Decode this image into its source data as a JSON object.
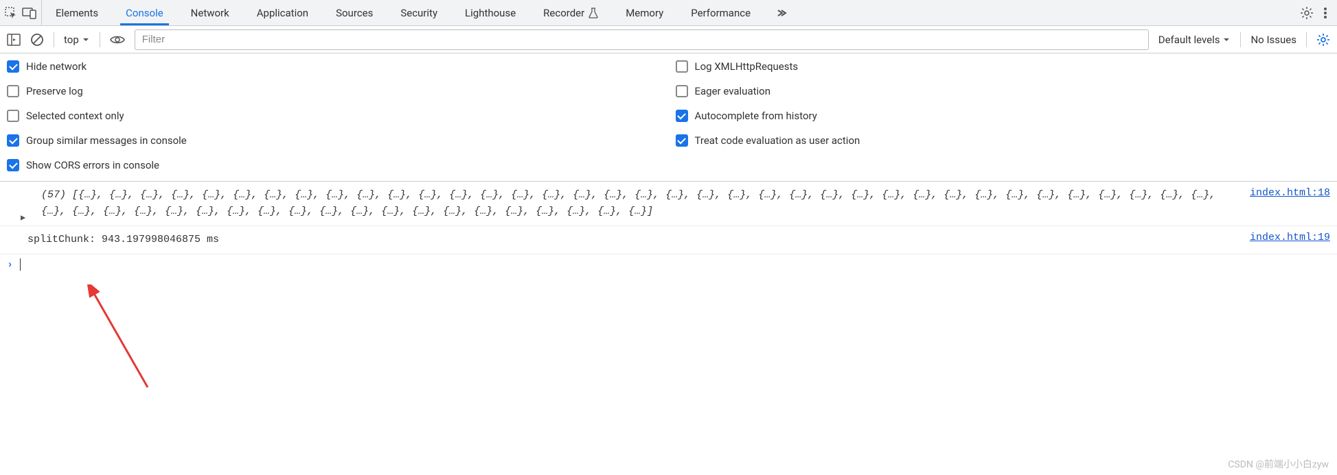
{
  "tabs": {
    "items": [
      "Elements",
      "Console",
      "Network",
      "Application",
      "Sources",
      "Security",
      "Lighthouse",
      "Recorder",
      "Memory",
      "Performance"
    ],
    "active": "Console",
    "recorder_experiment": true
  },
  "toolbar": {
    "context": "top",
    "filter_placeholder": "Filter",
    "levels_label": "Default levels",
    "issues_label": "No Issues"
  },
  "settings": {
    "left": [
      {
        "label": "Hide network",
        "checked": true
      },
      {
        "label": "Preserve log",
        "checked": false
      },
      {
        "label": "Selected context only",
        "checked": false
      },
      {
        "label": "Group similar messages in console",
        "checked": true
      },
      {
        "label": "Show CORS errors in console",
        "checked": true
      }
    ],
    "right": [
      {
        "label": "Log XMLHttpRequests",
        "checked": false
      },
      {
        "label": "Eager evaluation",
        "checked": false
      },
      {
        "label": "Autocomplete from history",
        "checked": true
      },
      {
        "label": "Treat code evaluation as user action",
        "checked": true
      }
    ]
  },
  "console": {
    "messages": [
      {
        "source": "index.html:18",
        "array_count": "(57)",
        "array_body": "[{…}, {…}, {…}, {…}, {…}, {…}, {…}, {…}, {…}, {…}, {…}, {…}, {…}, {…}, {…}, {…}, {…}, {…}, {…}, {…}, {…}, {…}, {…}, {…}, {…}, {…}, {…}, {…}, {…}, {…}, {…}, {…}, {…}, {…}, {…}, {…}, {…}, {…}, {…}, {…}, {…}, {…}, {…}, {…}, {…}, {…}, {…}, {…}, {…}, {…}, {…}, {…}, {…}, {…}, {…}, {…}, {…}]"
      },
      {
        "source": "index.html:19",
        "timing": "splitChunk: 943.197998046875 ms"
      }
    ]
  },
  "watermark": "CSDN @前端小小白zyw"
}
